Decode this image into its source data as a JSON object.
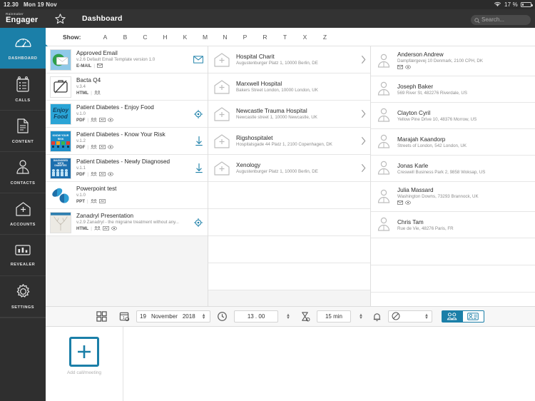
{
  "statusbar": {
    "time": "12.30",
    "date": "Mon 19 Nov",
    "battery": "17 %",
    "wifi_icon": "wifi-icon",
    "battery_icon": "battery-icon"
  },
  "header": {
    "logo_small": "Rainmaker",
    "logo_large": "Engager",
    "star_icon": "star-icon",
    "title": "Dashboard",
    "search": {
      "placeholder": "Search...",
      "value": "",
      "icon": "search-icon"
    }
  },
  "sidebar": {
    "items": [
      {
        "label": "DASHBOARD",
        "icon": "gauge-icon",
        "active": true
      },
      {
        "label": "CALLS",
        "icon": "clipboard-icon",
        "active": false
      },
      {
        "label": "CONTENT",
        "icon": "document-icon",
        "active": false
      },
      {
        "label": "CONTACTS",
        "icon": "person-icon",
        "active": false
      },
      {
        "label": "ACCOUNTS",
        "icon": "hospital-icon",
        "active": false
      },
      {
        "label": "REVEALER",
        "icon": "bars-icon",
        "active": false
      },
      {
        "label": "SETTINGS",
        "icon": "gear-icon",
        "active": false
      }
    ]
  },
  "showbar": {
    "label": "Show:",
    "letters": [
      "A",
      "B",
      "C",
      "H",
      "K",
      "M",
      "N",
      "P",
      "R",
      "T",
      "X",
      "Z"
    ]
  },
  "content_column": {
    "items": [
      {
        "title": "Approved Email",
        "subtitle": "v.2.6 Default Email Template version 1.0",
        "type": "E-MAIL",
        "meta_icons": [
          "envelope-icon"
        ],
        "action_icon": "envelope-icon",
        "thumb_text": "",
        "thumb_bg": "#8fc9e8"
      },
      {
        "title": "Bacta Q4",
        "subtitle": "v.3.4",
        "type": "HTML",
        "meta_icons": [
          "people-icon"
        ],
        "action_icon": "",
        "thumb_text": "",
        "thumb_bg": "#ffffff"
      },
      {
        "title": "Patient Diabetes - Enjoy Food",
        "subtitle": "v.1.0",
        "type": "PDF",
        "meta_icons": [
          "people-icon",
          "presentation-icon",
          "eye-icon"
        ],
        "action_icon": "target-icon",
        "thumb_text": "Enjoy Food",
        "thumb_bg": "#2aa4d6"
      },
      {
        "title": "Patient Diabetes - Know Your Risk",
        "subtitle": "v.1.2",
        "type": "PDF",
        "meta_icons": [
          "people-icon",
          "presentation-icon",
          "eye-icon"
        ],
        "action_icon": "download-icon",
        "thumb_text": "KNOW YOUR RISK",
        "thumb_bg": "#1f8fc8"
      },
      {
        "title": "Patient Diabetes - Newly Diagnosed",
        "subtitle": "v.1.1",
        "type": "PDF",
        "meta_icons": [
          "people-icon",
          "presentation-icon",
          "eye-icon"
        ],
        "action_icon": "download-icon",
        "thumb_text": "DIAGNOSED WITH DIABETES",
        "thumb_bg": "#1c6fae"
      },
      {
        "title": "Powerpoint test",
        "subtitle": "v.1.0",
        "type": "PPT",
        "meta_icons": [
          "people-icon",
          "presentation-icon"
        ],
        "action_icon": "",
        "thumb_text": "",
        "thumb_bg": "#ffffff"
      },
      {
        "title": "Zanadryl Presentation",
        "subtitle": "v.2.9 Zanadryl - the migraine treatment without any...",
        "type": "HTML",
        "meta_icons": [
          "people-icon",
          "presentation-icon",
          "eye-icon"
        ],
        "action_icon": "target-icon",
        "thumb_text": "",
        "thumb_bg": "#eeeeee"
      }
    ]
  },
  "accounts_column": {
    "items": [
      {
        "name": "Hospital Charit",
        "address": "Augustenburger Platz 1, 10000 Berlin, DE",
        "icon": "hospital-icon",
        "chevron": true
      },
      {
        "name": "Marxwell Hospital",
        "address": "Bakers Street London, 10000 London, UK",
        "icon": "hospital-icon",
        "chevron": false
      },
      {
        "name": "Newcastle Trauma Hospital",
        "address": "Newcastle street 1, 10000 Newcastle, UK",
        "icon": "hospital-icon",
        "chevron": true
      },
      {
        "name": "Rigshospitalet",
        "address": "Hospitalsgade 44 Platz 1, 2100 Copenhagen, DK",
        "icon": "hospital-icon",
        "chevron": true
      },
      {
        "name": "Xenology",
        "address": "Augustenburger Platz 1, 10000 Berlin, DE",
        "icon": "hospital-icon",
        "chevron": true
      }
    ]
  },
  "contacts_column": {
    "items": [
      {
        "name": "Anderson Andrew",
        "address": "Dampfærgevej 10 Denmark, 2100 CPH, DK",
        "icon": "person-icon",
        "badges": [
          "envelope-icon",
          "eye-icon"
        ]
      },
      {
        "name": "Joseph Baker",
        "address": "569 River St, 482276 Riverdale, US",
        "icon": "person-icon",
        "badges": []
      },
      {
        "name": "Clayton Cyril",
        "address": "Yellow Pine Drive 10, 48376 Morrow, US",
        "icon": "person-icon",
        "badges": []
      },
      {
        "name": "Marajah Kaandorp",
        "address": "Streets of London, 542 London, UK",
        "icon": "person-icon",
        "badges": []
      },
      {
        "name": "Jonas Karle",
        "address": "Creswell Business Park 2, 9858 Woksap, US",
        "icon": "person-icon",
        "badges": []
      },
      {
        "name": "Julia Massard",
        "address": "Washington Downs, 73293 Brannock, UK",
        "icon": "person-icon",
        "badges": [
          "envelope-icon",
          "eye-icon"
        ]
      },
      {
        "name": "Chris Tam",
        "address": "Rue de Vie, 48276 Paris, FR",
        "icon": "person-icon",
        "badges": []
      }
    ]
  },
  "toolbar": {
    "grid_icon": "grid-view-icon",
    "calendar_icon": "calendar-icon",
    "day": "19",
    "month": "November",
    "year": "2018",
    "clock_icon": "clock-icon",
    "time": "13 . 00",
    "duration_icon": "hourglass-icon",
    "duration": "15 min",
    "bell_icon": "bell-icon",
    "none_icon": "no-symbol-icon",
    "toggle_people_icon": "two-people-icon",
    "toggle_card_icon": "person-card-icon"
  },
  "bottom": {
    "add_label": "Add call/meeting",
    "add_icon": "plus-icon"
  },
  "colors": {
    "accent": "#1b7fa8",
    "sidebar": "#2f2f2f",
    "header": "#333333"
  }
}
